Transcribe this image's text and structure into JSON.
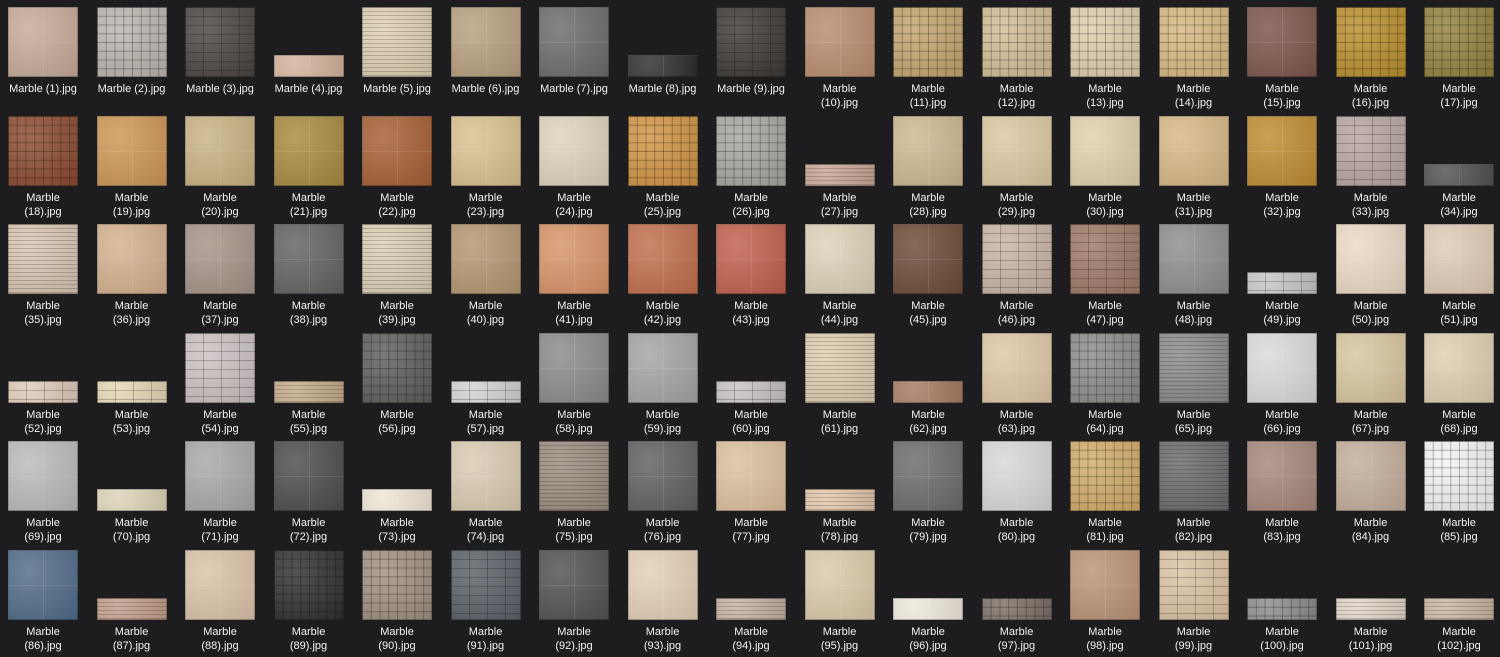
{
  "colors": {
    "background": "#1d1d1f",
    "label_text": "#f4f4f4"
  },
  "files": [
    {
      "name": "Marble (1).jpg",
      "color": "#c7a996",
      "pattern": "grid",
      "height": "square"
    },
    {
      "name": "Marble (2).jpg",
      "color": "#bdb5ae",
      "pattern": "mosaic",
      "height": "square"
    },
    {
      "name": "Marble (3).jpg",
      "color": "#4a4440",
      "pattern": "brick",
      "height": "square"
    },
    {
      "name": "Marble (4).jpg",
      "color": "#d2b39c",
      "pattern": "grid",
      "height": "short"
    },
    {
      "name": "Marble (5).jpg",
      "color": "#dfd1b4",
      "pattern": "fine",
      "height": "square"
    },
    {
      "name": "Marble (6).jpg",
      "color": "#b79f7e",
      "pattern": "grid",
      "height": "square"
    },
    {
      "name": "Marble (7).jpg",
      "color": "#6a6a6b",
      "pattern": "grid",
      "height": "square"
    },
    {
      "name": "Marble (8).jpg",
      "color": "#2d2d31",
      "pattern": "grid",
      "height": "short"
    },
    {
      "name": "Marble (9).jpg",
      "color": "#3c3834",
      "pattern": "brick",
      "height": "square"
    },
    {
      "name": "Marble\n(10).jpg",
      "color": "#b98c6d",
      "pattern": "grid",
      "height": "square"
    },
    {
      "name": "Marble\n(11).jpg",
      "color": "#c3a56f",
      "pattern": "mosaic",
      "height": "square"
    },
    {
      "name": "Marble\n(12).jpg",
      "color": "#d4bd96",
      "pattern": "mosaic",
      "height": "square"
    },
    {
      "name": "Marble\n(13).jpg",
      "color": "#dfceac",
      "pattern": "mosaic",
      "height": "square"
    },
    {
      "name": "Marble\n(14).jpg",
      "color": "#d7b982",
      "pattern": "mosaic",
      "height": "square"
    },
    {
      "name": "Marble\n(15).jpg",
      "color": "#7b5448",
      "pattern": "grid",
      "height": "square"
    },
    {
      "name": "Marble\n(16).jpg",
      "color": "#b98f2d",
      "pattern": "mosaic",
      "height": "square"
    },
    {
      "name": "Marble\n(17).jpg",
      "color": "#94823f",
      "pattern": "mosaic",
      "height": "square"
    },
    {
      "name": "Marble\n(18).jpg",
      "color": "#8b4a2f",
      "pattern": "mosaic",
      "height": "square"
    },
    {
      "name": "Marble\n(19).jpg",
      "color": "#cc9654",
      "pattern": "grid",
      "height": "square"
    },
    {
      "name": "Marble\n(20).jpg",
      "color": "#c9b182",
      "pattern": "grid",
      "height": "square"
    },
    {
      "name": "Marble\n(21).jpg",
      "color": "#a88a3f",
      "pattern": "grid",
      "height": "square"
    },
    {
      "name": "Marble\n(22).jpg",
      "color": "#a55e32",
      "pattern": "grid",
      "height": "square"
    },
    {
      "name": "Marble\n(23).jpg",
      "color": "#d9c08f",
      "pattern": "grid",
      "height": "square"
    },
    {
      "name": "Marble\n(24).jpg",
      "color": "#dfd3ba",
      "pattern": "grid",
      "height": "square"
    },
    {
      "name": "Marble\n(25).jpg",
      "color": "#d09343",
      "pattern": "mosaic",
      "height": "square"
    },
    {
      "name": "Marble\n(26).jpg",
      "color": "#a8a6a0",
      "pattern": "mosaic",
      "height": "square"
    },
    {
      "name": "Marble\n(27).jpg",
      "color": "#c8a794",
      "pattern": "fine",
      "height": "short"
    },
    {
      "name": "Marble\n(28).jpg",
      "color": "#cdb78f",
      "pattern": "grid",
      "height": "square"
    },
    {
      "name": "Marble\n(29).jpg",
      "color": "#dcc8a1",
      "pattern": "grid",
      "height": "square"
    },
    {
      "name": "Marble\n(30).jpg",
      "color": "#e1d0ad",
      "pattern": "grid",
      "height": "square"
    },
    {
      "name": "Marble\n(31).jpg",
      "color": "#d7b786",
      "pattern": "grid",
      "height": "square"
    },
    {
      "name": "Marble\n(32).jpg",
      "color": "#bf8b31",
      "pattern": "grid",
      "height": "square"
    },
    {
      "name": "Marble\n(33).jpg",
      "color": "#b7a5a0",
      "pattern": "brick",
      "height": "square"
    },
    {
      "name": "Marble\n(34).jpg",
      "color": "#505050",
      "pattern": "grid",
      "height": "short"
    },
    {
      "name": "Marble\n(35).jpg",
      "color": "#dac6b2",
      "pattern": "fine",
      "height": "square"
    },
    {
      "name": "Marble\n(36).jpg",
      "color": "#d4b18d",
      "pattern": "grid",
      "height": "square"
    },
    {
      "name": "Marble\n(37).jpg",
      "color": "#a59287",
      "pattern": "grid",
      "height": "square"
    },
    {
      "name": "Marble\n(38).jpg",
      "color": "#61615f",
      "pattern": "grid",
      "height": "square"
    },
    {
      "name": "Marble\n(39).jpg",
      "color": "#ddd0b6",
      "pattern": "fine",
      "height": "square"
    },
    {
      "name": "Marble\n(40).jpg",
      "color": "#b39670",
      "pattern": "grid",
      "height": "square"
    },
    {
      "name": "Marble\n(41).jpg",
      "color": "#d79367",
      "pattern": "grid",
      "height": "square"
    },
    {
      "name": "Marble\n(42).jpg",
      "color": "#c16d4c",
      "pattern": "grid",
      "height": "square"
    },
    {
      "name": "Marble\n(43).jpg",
      "color": "#c05f4b",
      "pattern": "grid",
      "height": "square"
    },
    {
      "name": "Marble\n(44).jpg",
      "color": "#ded2b8",
      "pattern": "grid",
      "height": "square"
    },
    {
      "name": "Marble\n(45).jpg",
      "color": "#6b4a36",
      "pattern": "grid",
      "height": "square"
    },
    {
      "name": "Marble\n(46).jpg",
      "color": "#c9b3a5",
      "pattern": "brick",
      "height": "square"
    },
    {
      "name": "Marble\n(47).jpg",
      "color": "#9d7865",
      "pattern": "brick",
      "height": "square"
    },
    {
      "name": "Marble\n(48).jpg",
      "color": "#8c8d8d",
      "pattern": "grid",
      "height": "square"
    },
    {
      "name": "Marble\n(49).jpg",
      "color": "#c6c5c7",
      "pattern": "brick",
      "height": "short"
    },
    {
      "name": "Marble\n(50).jpg",
      "color": "#ebd9c5",
      "pattern": "grid",
      "height": "square"
    },
    {
      "name": "Marble\n(51).jpg",
      "color": "#e0cbb5",
      "pattern": "grid",
      "height": "square"
    },
    {
      "name": "Marble\n(52).jpg",
      "color": "#e0cab8",
      "pattern": "brick",
      "height": "short"
    },
    {
      "name": "Marble\n(53).jpg",
      "color": "#e5d7b5",
      "pattern": "brick",
      "height": "short"
    },
    {
      "name": "Marble\n(54).jpg",
      "color": "#ccc1c1",
      "pattern": "brick",
      "height": "square"
    },
    {
      "name": "Marble\n(55).jpg",
      "color": "#c7ad8b",
      "pattern": "fine",
      "height": "short"
    },
    {
      "name": "Marble\n(56).jpg",
      "color": "#5f5d5a",
      "pattern": "mosaic",
      "height": "square"
    },
    {
      "name": "Marble\n(57).jpg",
      "color": "#d2d3d6",
      "pattern": "brick",
      "height": "short"
    },
    {
      "name": "Marble\n(58).jpg",
      "color": "#898a8c",
      "pattern": "grid",
      "height": "square"
    },
    {
      "name": "Marble\n(59).jpg",
      "color": "#a3a4a6",
      "pattern": "grid",
      "height": "square"
    },
    {
      "name": "Marble\n(60).jpg",
      "color": "#c7c1c4",
      "pattern": "brick",
      "height": "short"
    },
    {
      "name": "Marble\n(61).jpg",
      "color": "#e2cfb2",
      "pattern": "fine",
      "height": "square"
    },
    {
      "name": "Marble\n(62).jpg",
      "color": "#a77a62",
      "pattern": "grid",
      "height": "short"
    },
    {
      "name": "Marble\n(63).jpg",
      "color": "#dfc7a7",
      "pattern": "grid",
      "height": "square"
    },
    {
      "name": "Marble\n(64).jpg",
      "color": "#8b8c89",
      "pattern": "mosaic",
      "height": "square"
    },
    {
      "name": "Marble\n(65).jpg",
      "color": "#8c8b8c",
      "pattern": "fine",
      "height": "square"
    },
    {
      "name": "Marble\n(66).jpg",
      "color": "#dadadb",
      "pattern": "grid",
      "height": "square"
    },
    {
      "name": "Marble\n(67).jpg",
      "color": "#d7c59d",
      "pattern": "grid",
      "height": "square"
    },
    {
      "name": "Marble\n(68).jpg",
      "color": "#dfcfb1",
      "pattern": "grid",
      "height": "square"
    },
    {
      "name": "Marble\n(69).jpg",
      "color": "#b9babd",
      "pattern": "grid",
      "height": "square"
    },
    {
      "name": "Marble\n(70).jpg",
      "color": "#ddd4b8",
      "pattern": "grid",
      "height": "short"
    },
    {
      "name": "Marble\n(71).jpg",
      "color": "#a8a8a9",
      "pattern": "grid",
      "height": "square"
    },
    {
      "name": "Marble\n(72).jpg",
      "color": "#4b4b4d",
      "pattern": "grid",
      "height": "square"
    },
    {
      "name": "Marble\n(73).jpg",
      "color": "#f0e6d7",
      "pattern": "grid",
      "height": "short"
    },
    {
      "name": "Marble\n(74).jpg",
      "color": "#dbcab0",
      "pattern": "grid",
      "height": "square"
    },
    {
      "name": "Marble\n(75).jpg",
      "color": "#9c8d80",
      "pattern": "fine",
      "height": "square"
    },
    {
      "name": "Marble\n(76).jpg",
      "color": "#5f5e60",
      "pattern": "grid",
      "height": "square"
    },
    {
      "name": "Marble\n(77).jpg",
      "color": "#dcc09d",
      "pattern": "grid",
      "height": "square"
    },
    {
      "name": "Marble\n(78).jpg",
      "color": "#e4c7ab",
      "pattern": "fine",
      "height": "short"
    },
    {
      "name": "Marble\n(79).jpg",
      "color": "#6a6a6a",
      "pattern": "grid",
      "height": "square"
    },
    {
      "name": "Marble\n(80).jpg",
      "color": "#d7d8da",
      "pattern": "grid",
      "height": "square"
    },
    {
      "name": "Marble\n(81).jpg",
      "color": "#d2ac69",
      "pattern": "mosaic",
      "height": "square"
    },
    {
      "name": "Marble\n(82).jpg",
      "color": "#6a6b6d",
      "pattern": "fine",
      "height": "square"
    },
    {
      "name": "Marble\n(83).jpg",
      "color": "#a58679",
      "pattern": "grid",
      "height": "square"
    },
    {
      "name": "Marble\n(84).jpg",
      "color": "#c3ad9a",
      "pattern": "grid",
      "height": "square"
    },
    {
      "name": "Marble\n(85).jpg",
      "color": "#f2f3f5",
      "pattern": "mosaic",
      "height": "square"
    },
    {
      "name": "Marble\n(86).jpg",
      "color": "#4f6a87",
      "pattern": "grid",
      "height": "square"
    },
    {
      "name": "Marble\n(87).jpg",
      "color": "#c49f8b",
      "pattern": "fine",
      "height": "short"
    },
    {
      "name": "Marble\n(88).jpg",
      "color": "#dbc3a8",
      "pattern": "grid",
      "height": "square"
    },
    {
      "name": "Marble\n(89).jpg",
      "color": "#2f2f31",
      "pattern": "mosaic",
      "height": "square"
    },
    {
      "name": "Marble\n(90).jpg",
      "color": "#a08f80",
      "pattern": "mosaic",
      "height": "square"
    },
    {
      "name": "Marble\n(91).jpg",
      "color": "#5a6068",
      "pattern": "brick",
      "height": "square"
    },
    {
      "name": "Marble\n(92).jpg",
      "color": "#505052",
      "pattern": "grid",
      "height": "square"
    },
    {
      "name": "Marble\n(93).jpg",
      "color": "#e4cfb6",
      "pattern": "grid",
      "height": "square"
    },
    {
      "name": "Marble\n(94).jpg",
      "color": "#c8b1a2",
      "pattern": "fine",
      "height": "short"
    },
    {
      "name": "Marble\n(95).jpg",
      "color": "#dcc9a9",
      "pattern": "grid",
      "height": "square"
    },
    {
      "name": "Marble\n(96).jpg",
      "color": "#efe8de",
      "pattern": "grid",
      "height": "short"
    },
    {
      "name": "Marble\n(97).jpg",
      "color": "#7b6f66",
      "pattern": "mosaic",
      "height": "short"
    },
    {
      "name": "Marble\n(98).jpg",
      "color": "#bb9377",
      "pattern": "grid",
      "height": "square"
    },
    {
      "name": "Marble\n(99).jpg",
      "color": "#dbc3a3",
      "pattern": "brick",
      "height": "square"
    },
    {
      "name": "Marble\n(100).jpg",
      "color": "#8c8c8c",
      "pattern": "mosaic",
      "height": "short"
    },
    {
      "name": "Marble\n(101).jpg",
      "color": "#e2d6c8",
      "pattern": "fine",
      "height": "short"
    },
    {
      "name": "Marble\n(102).jpg",
      "color": "#cdb7a1",
      "pattern": "fine",
      "height": "short"
    }
  ]
}
